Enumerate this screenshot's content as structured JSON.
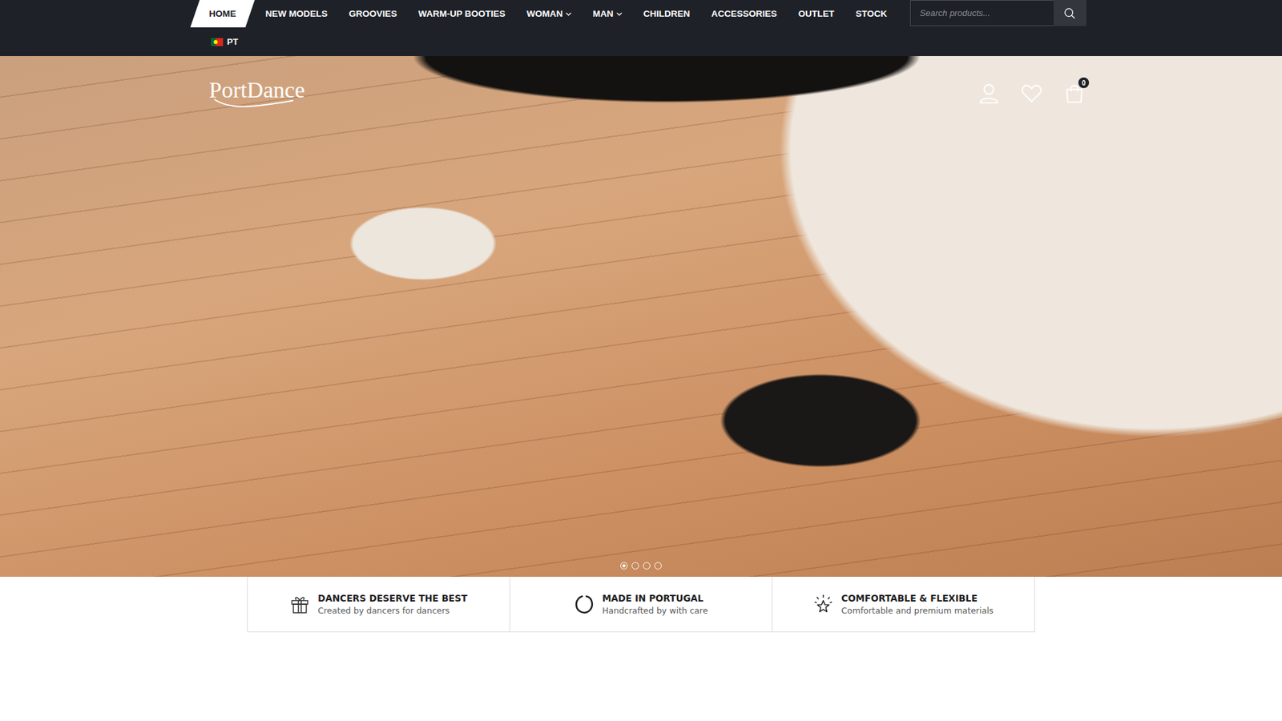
{
  "nav": {
    "items": [
      {
        "label": "HOME",
        "selected": true,
        "dropdown": false
      },
      {
        "label": "NEW MODELS",
        "selected": false,
        "dropdown": false
      },
      {
        "label": "GROOVIES",
        "selected": false,
        "dropdown": false
      },
      {
        "label": "WARM-UP BOOTIES",
        "selected": false,
        "dropdown": false
      },
      {
        "label": "WOMAN",
        "selected": false,
        "dropdown": true
      },
      {
        "label": "MAN",
        "selected": false,
        "dropdown": true
      },
      {
        "label": "CHILDREN",
        "selected": false,
        "dropdown": false
      },
      {
        "label": "ACCESSORIES",
        "selected": false,
        "dropdown": false
      },
      {
        "label": "OUTLET",
        "selected": false,
        "dropdown": false
      },
      {
        "label": "STOCK",
        "selected": false,
        "dropdown": false
      }
    ],
    "search": {
      "placeholder": "Search products..."
    },
    "language": {
      "code": "PT"
    }
  },
  "header": {
    "logo": "PortDance",
    "cart": {
      "count": "0"
    }
  },
  "slider": {
    "dots": [
      {
        "selected": true
      },
      {
        "selected": false
      },
      {
        "selected": false
      },
      {
        "selected": false
      }
    ]
  },
  "features": [
    {
      "title": "DANCERS DESERVE THE BEST",
      "subtitle": "Created by dancers for dancers"
    },
    {
      "title": "MADE IN PORTUGAL",
      "subtitle": "Handcrafted by with care"
    },
    {
      "title": "COMFORTABLE & FLEXIBLE",
      "subtitle": "Comfortable and premium materials"
    }
  ]
}
